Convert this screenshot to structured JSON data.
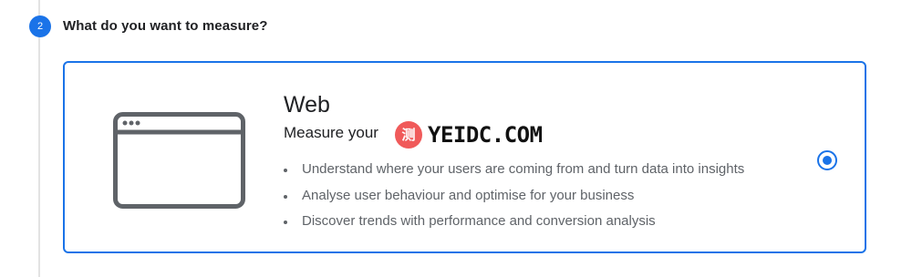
{
  "step": {
    "number": "2",
    "title": "What do you want to measure?"
  },
  "option": {
    "title": "Web",
    "subtitle": "Measure your",
    "icon": "browser-window-icon",
    "selected": true,
    "bullets": [
      "Understand where your users are coming from and turn data into insights",
      "Analyse user behaviour and optimise for your business",
      "Discover trends with performance and conversion analysis"
    ]
  },
  "watermark": {
    "logo_text": "测",
    "text": "YEIDC.COM"
  },
  "colors": {
    "accent": "#1a73e8",
    "text_primary": "#202124",
    "text_secondary": "#5f6368",
    "icon_stroke": "#5f6368"
  }
}
